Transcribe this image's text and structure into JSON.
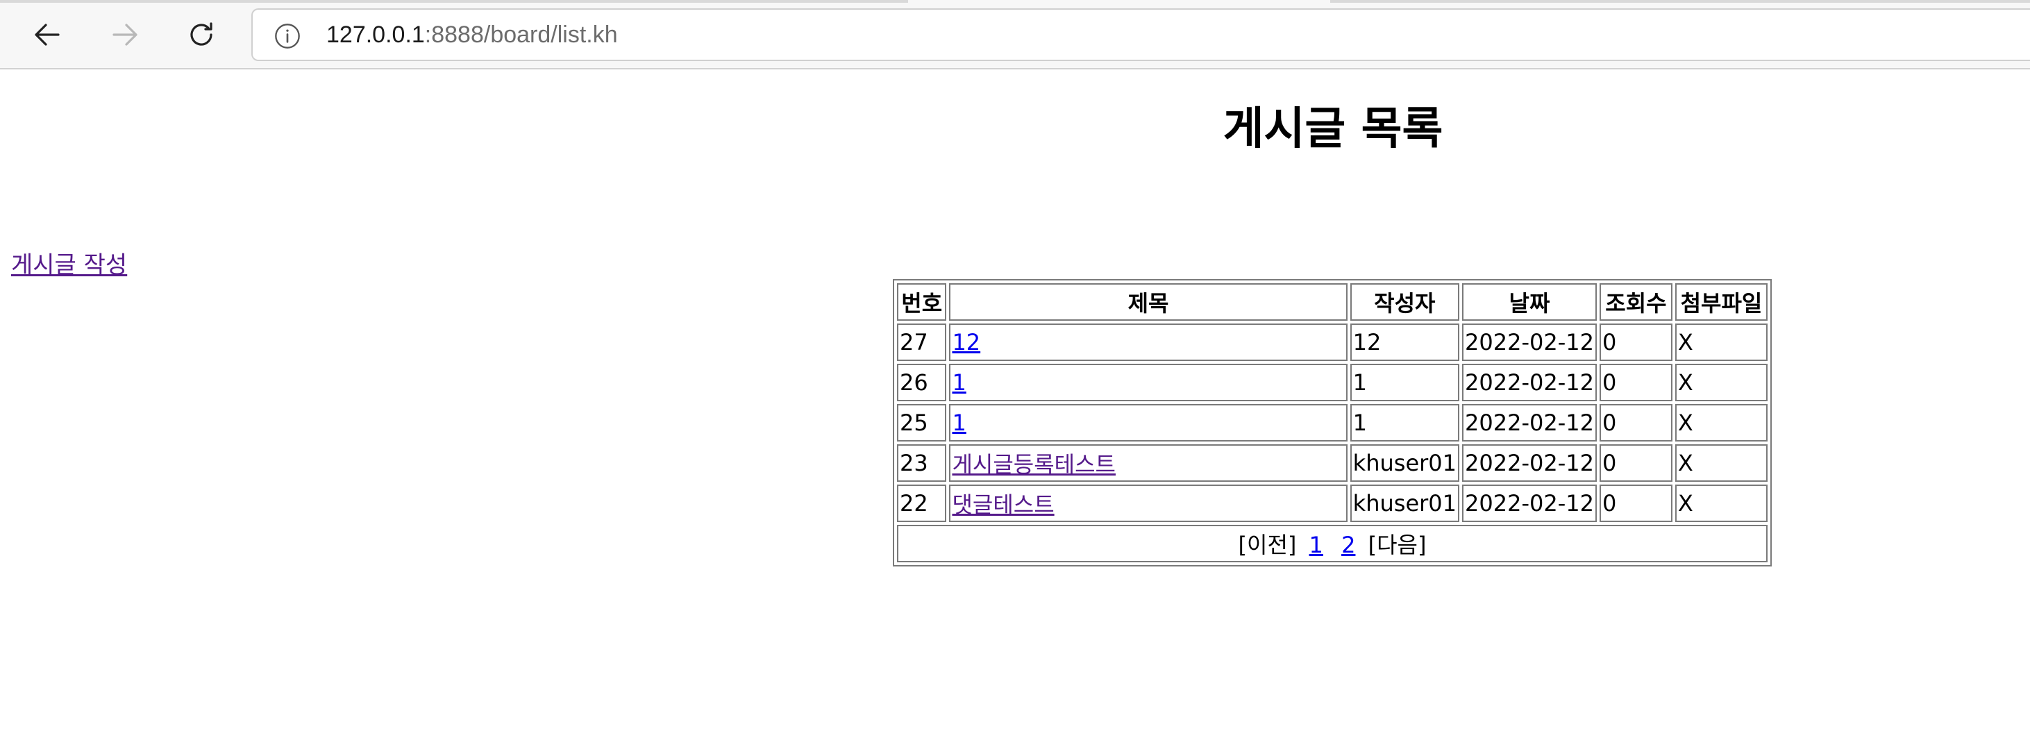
{
  "browser": {
    "url_host": "127.0.0.1",
    "url_path": ":8888/board/list.kh",
    "icons": [
      "back-arrow-icon",
      "forward-arrow-icon",
      "reload-icon",
      "info-icon"
    ]
  },
  "page": {
    "title": "게시글 목록",
    "write_link": "게시글 작성"
  },
  "table": {
    "headers": [
      "번호",
      "제목",
      "작성자",
      "날짜",
      "조회수",
      "첨부파일"
    ],
    "rows": [
      {
        "no": "27",
        "title": "12",
        "writer": "12",
        "date": "2022-02-12",
        "views": "0",
        "file": "X"
      },
      {
        "no": "26",
        "title": "1",
        "writer": "1",
        "date": "2022-02-12",
        "views": "0",
        "file": "X"
      },
      {
        "no": "25",
        "title": "1",
        "writer": "1",
        "date": "2022-02-12",
        "views": "0",
        "file": "X"
      },
      {
        "no": "23",
        "title": "게시글등록테스트",
        "writer": "khuser01",
        "date": "2022-02-12",
        "views": "0",
        "file": "X"
      },
      {
        "no": "22",
        "title": "댓글테스트",
        "writer": "khuser01",
        "date": "2022-02-12",
        "views": "0",
        "file": "X"
      }
    ]
  },
  "pagination": {
    "prev": "[이전]",
    "pages": [
      "1",
      "2"
    ],
    "next": "[다음]"
  },
  "colors": {
    "link": "#0000ee",
    "visited_link": "#551a8b"
  }
}
